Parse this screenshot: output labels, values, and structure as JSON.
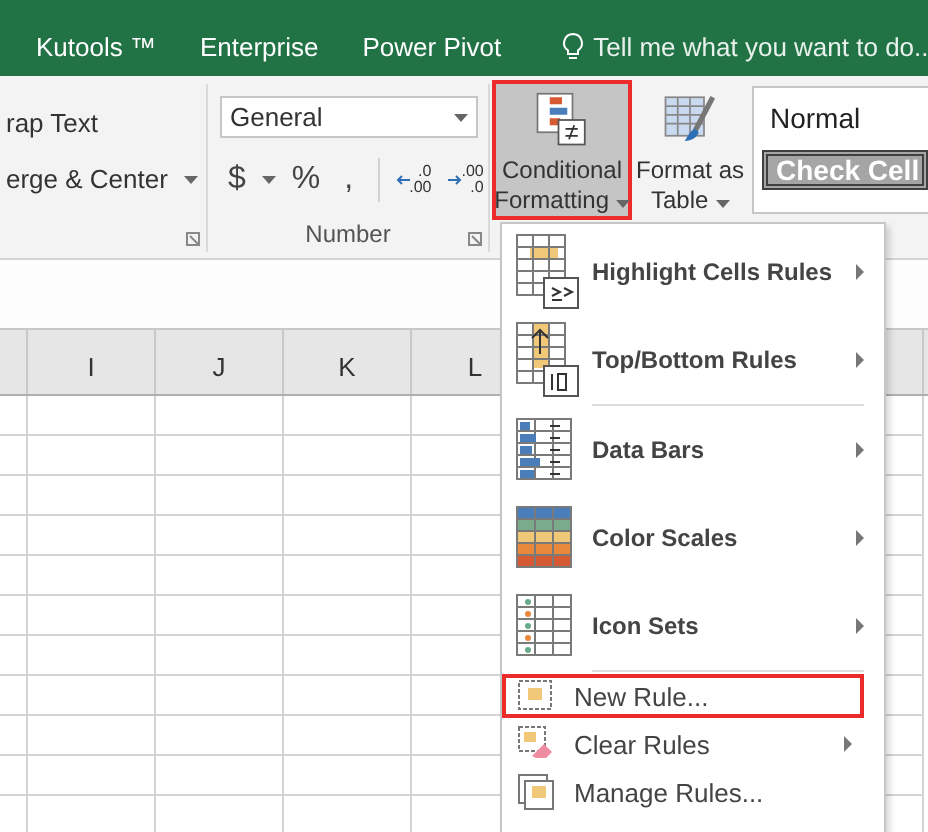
{
  "ribbon_tabs": [
    {
      "label": "Kutools ™"
    },
    {
      "label": "Enterprise"
    },
    {
      "label": "Power Pivot"
    }
  ],
  "tell_me": {
    "placeholder": "Tell me what you want to do..."
  },
  "alignment": {
    "buttons": [
      {
        "label": "rap Text",
        "dropdown": false
      },
      {
        "label": "erge & Center",
        "dropdown": true
      }
    ]
  },
  "number": {
    "format": "General",
    "symbols": [
      "$",
      "%",
      ","
    ],
    "decimals": [
      {
        "lines": [
          ".0",
          ".00"
        ]
      },
      {
        "lines": [
          ".00",
          ".0"
        ]
      }
    ],
    "label": "Number"
  },
  "styles": {
    "conditional_formatting": {
      "lines": [
        "Conditional",
        "Formatting"
      ],
      "highlighted": true,
      "selected": true
    },
    "format_as_table": {
      "lines": [
        "Format as",
        "Table"
      ]
    },
    "cell_styles": [
      {
        "label": "Normal",
        "kind": "normal"
      },
      {
        "label": "Check Cell",
        "kind": "check"
      }
    ]
  },
  "columns": [
    "I",
    "J",
    "K",
    "L"
  ],
  "menu": {
    "large_items": [
      {
        "kind": "highlight",
        "label": "Highlight Cells Rules",
        "submenu": true,
        "divider_after": false
      },
      {
        "kind": "topbottom",
        "label": "Top/Bottom Rules",
        "submenu": true,
        "divider_after": true
      },
      {
        "kind": "databars",
        "label": "Data Bars",
        "submenu": true,
        "divider_after": false
      },
      {
        "kind": "colorscales",
        "label": "Color Scales",
        "submenu": true,
        "divider_after": false
      },
      {
        "kind": "iconsets",
        "label": "Icon Sets",
        "submenu": true,
        "divider_after": true
      }
    ],
    "small_items": [
      {
        "kind": "newrule",
        "label": "New Rule...",
        "submenu": false,
        "highlighted": true
      },
      {
        "kind": "clearrules",
        "label": "Clear Rules",
        "submenu": true,
        "highlighted": false
      },
      {
        "kind": "managerules",
        "label": "Manage Rules...",
        "submenu": false,
        "highlighted": false
      }
    ]
  }
}
